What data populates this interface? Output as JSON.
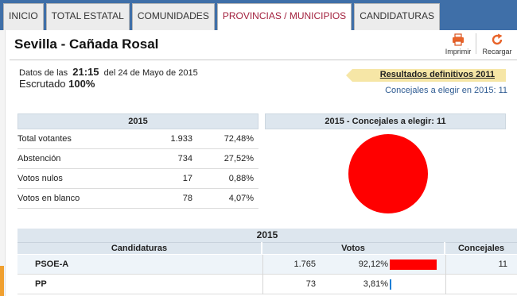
{
  "nav": {
    "tabs": [
      {
        "label": "INICIO",
        "active": false
      },
      {
        "label": "TOTAL ESTATAL",
        "active": false
      },
      {
        "label": "COMUNIDADES",
        "active": false
      },
      {
        "label": "PROVINCIAS / MUNICIPIOS",
        "active": true
      },
      {
        "label": "CANDIDATURAS",
        "active": false
      }
    ]
  },
  "header": {
    "title": "Sevilla - Cañada Rosal",
    "print_label": "Imprimir",
    "print_icon": "printer-icon",
    "reload_label": "Recargar",
    "reload_icon": "reload-icon"
  },
  "info": {
    "date_prefix": "Datos de las",
    "time": "21:15",
    "date_suffix": "del 24 de Mayo de 2015",
    "scrutiny_label": "Escrutado",
    "scrutiny_value": "100%",
    "previous_results_link": "Resultados definitivos 2011",
    "seats_note": "Concejales a elegir en 2015: 11"
  },
  "summary": {
    "title": "2015",
    "rows": [
      {
        "label": "Total votantes",
        "value": "1.933",
        "pct": "72,48%"
      },
      {
        "label": "Abstención",
        "value": "734",
        "pct": "27,52%"
      },
      {
        "label": "Votos nulos",
        "value": "17",
        "pct": "0,88%"
      },
      {
        "label": "Votos en blanco",
        "value": "78",
        "pct": "4,07%"
      }
    ]
  },
  "seats_chart": {
    "title": "2015 - Concejales a elegir: 11",
    "slices": [
      {
        "party": "PSOE-A",
        "seats": 11,
        "color": "#ff0000"
      }
    ]
  },
  "results": {
    "title": "2015",
    "headers": {
      "party": "Candidaturas",
      "votes": "Votos",
      "seats": "Concejales"
    },
    "rows": [
      {
        "party": "PSOE-A",
        "votes": "1.765",
        "pct": "92,12%",
        "share": 0.9212,
        "seats": "11",
        "color": "#ff0000"
      },
      {
        "party": "PP",
        "votes": "73",
        "pct": "3,81%",
        "share": 0.0381,
        "seats": "",
        "color": "#1e7fd6"
      }
    ]
  }
}
